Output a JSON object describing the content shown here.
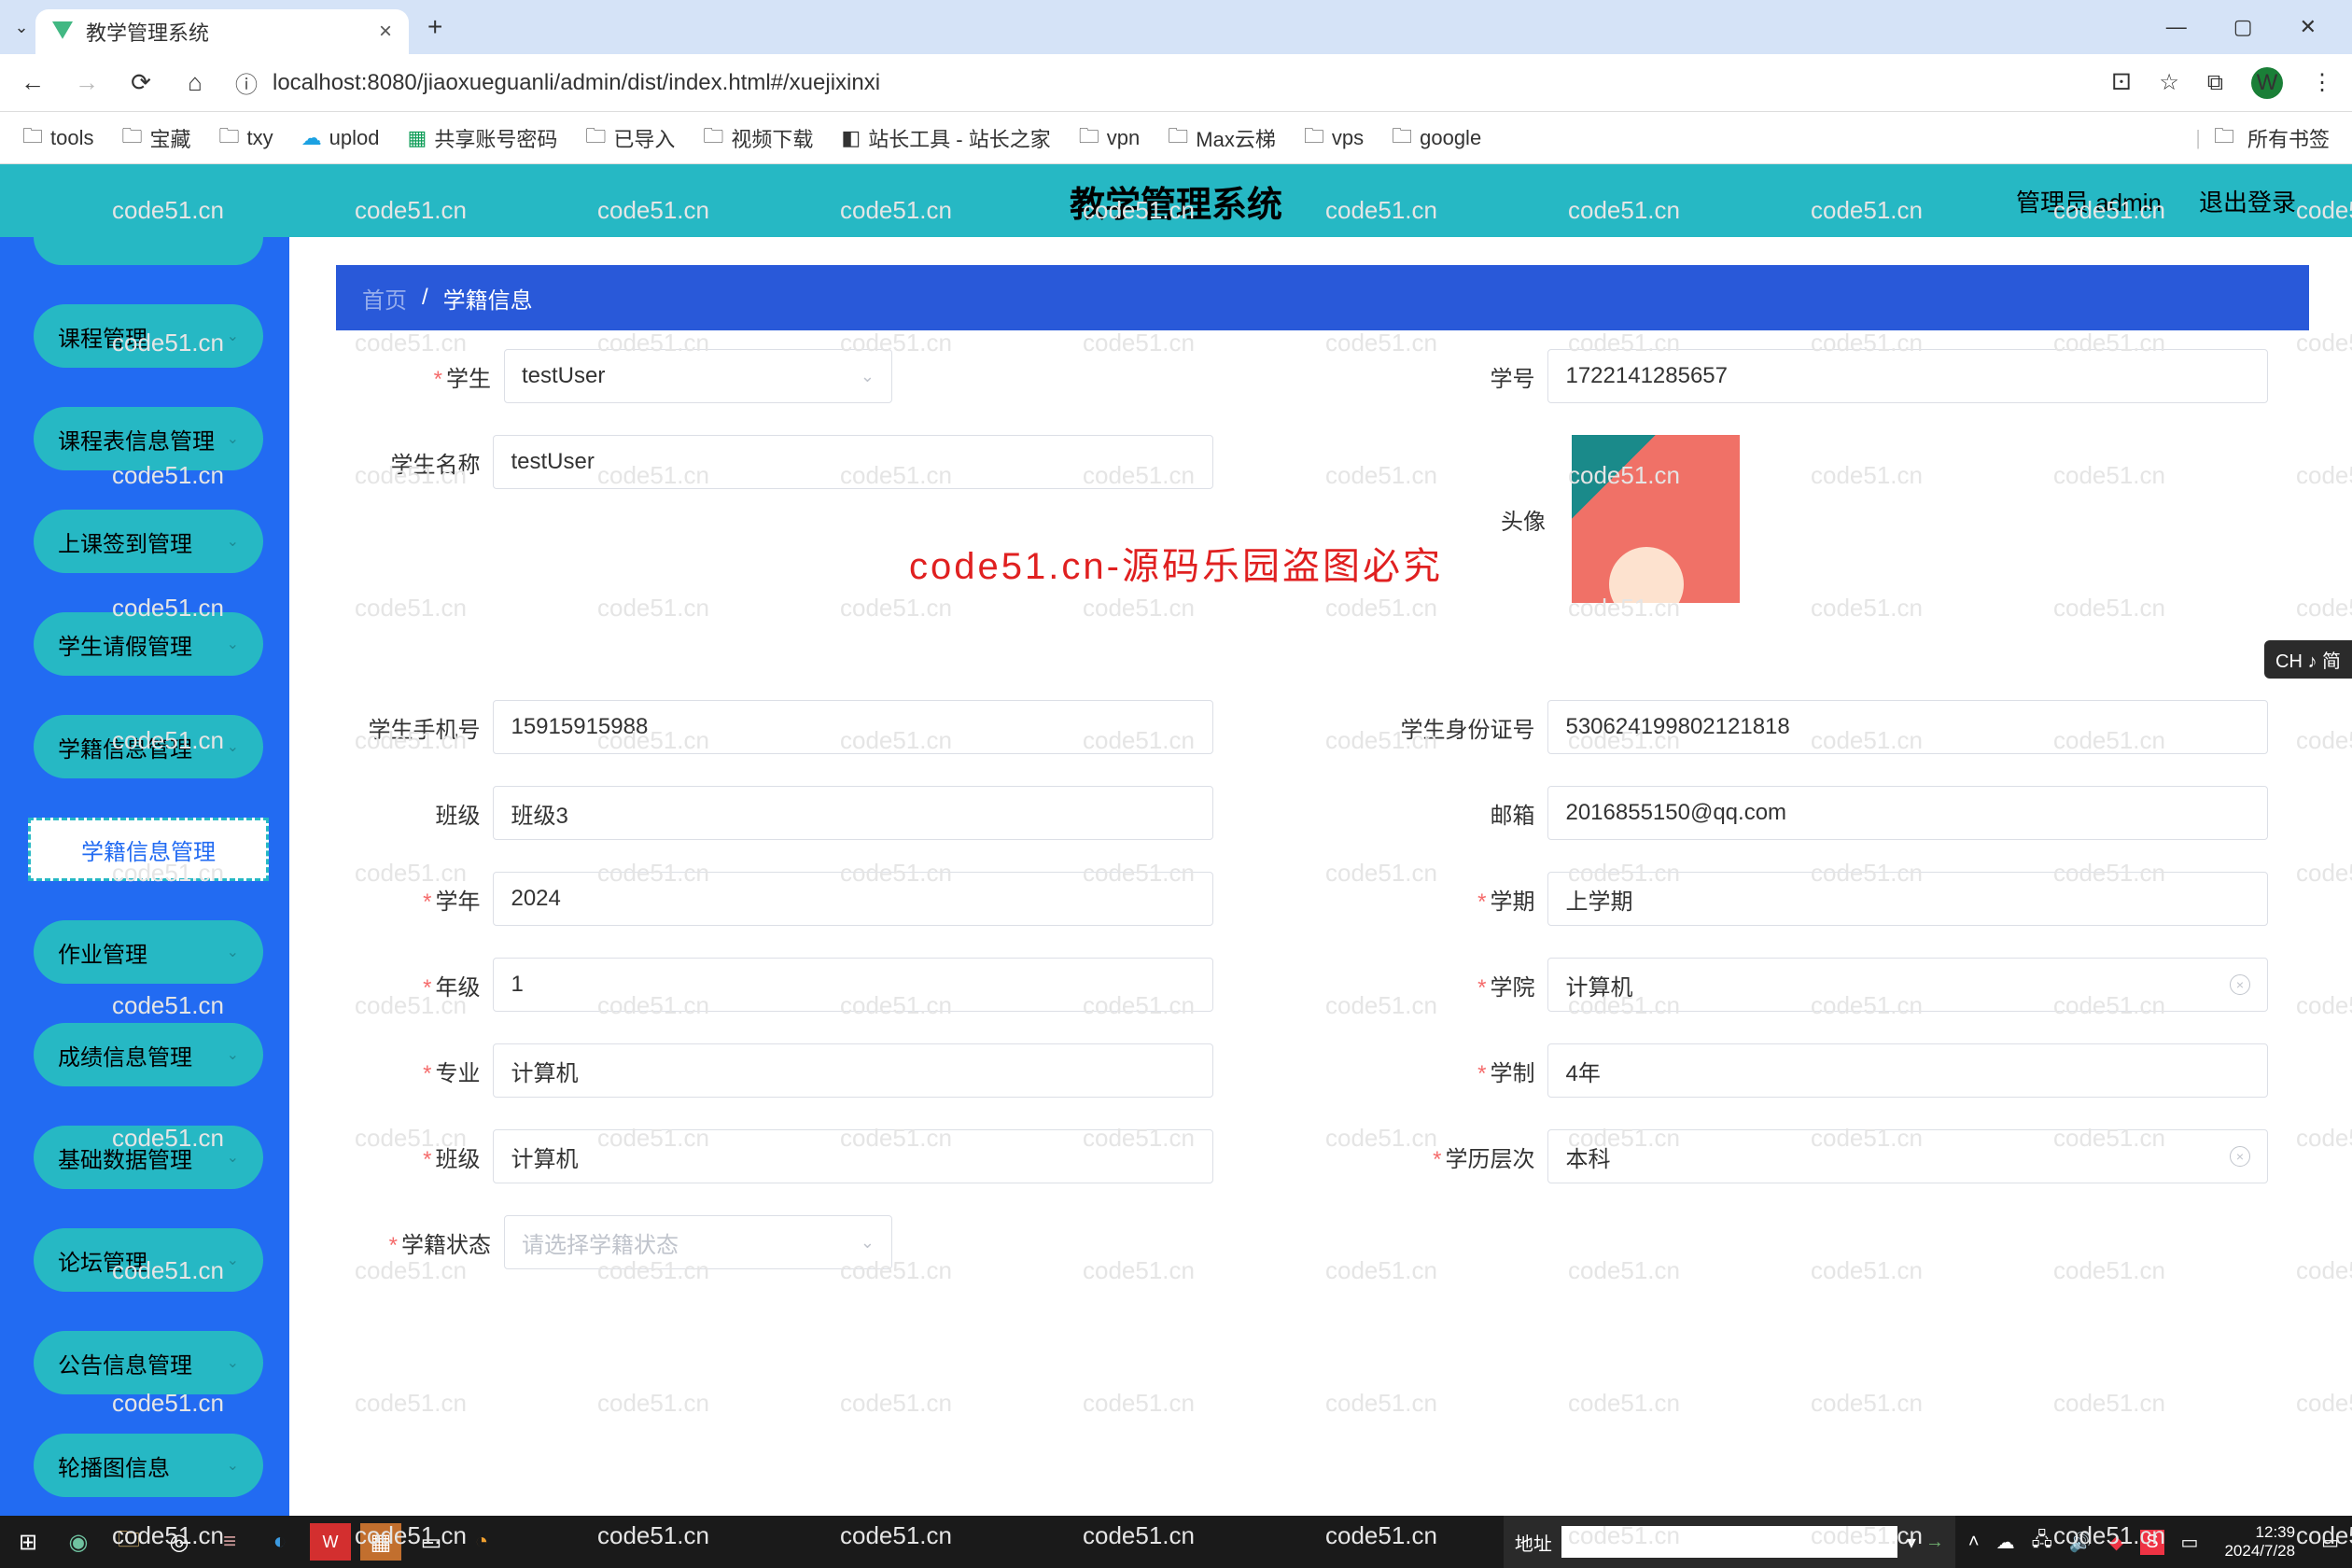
{
  "browser": {
    "tab_title": "教学管理系统",
    "url": "localhost:8080/jiaoxueguanli/admin/dist/index.html#/xuejixinxi",
    "avatar_letter": "W"
  },
  "bookmarks": {
    "items": [
      "tools",
      "宝藏",
      "txy",
      "uplod",
      "共享账号密码",
      "已导入",
      "视频下载",
      "站长工具 - 站长之家",
      "vpn",
      "Max云梯",
      "vps",
      "google"
    ],
    "right": "所有书签"
  },
  "app": {
    "title": "教学管理系统",
    "admin_label": "管理员 admin",
    "logout": "退出登录"
  },
  "sidebar": {
    "items": [
      "课程管理",
      "课程表信息管理",
      "上课签到管理",
      "学生请假管理",
      "学籍信息管理"
    ],
    "active": "学籍信息管理",
    "rest": [
      "作业管理",
      "成绩信息管理",
      "基础数据管理",
      "论坛管理",
      "公告信息管理",
      "轮播图信息"
    ]
  },
  "breadcrumb": {
    "home": "首页",
    "current": "学籍信息"
  },
  "form": {
    "student_label": "学生",
    "student_value": "testUser",
    "student_no_label": "学号",
    "student_no_value": "1722141285657",
    "student_name_label": "学生名称",
    "student_name_value": "testUser",
    "avatar_label": "头像",
    "phone_label": "学生手机号",
    "phone_value": "15915915988",
    "idcard_label": "学生身份证号",
    "idcard_value": "530624199802121818",
    "class_label": "班级",
    "class_value": "班级3",
    "email_label": "邮箱",
    "email_value": "2016855150@qq.com",
    "year_label": "学年",
    "year_value": "2024",
    "semester_label": "学期",
    "semester_value": "上学期",
    "grade_label": "年级",
    "grade_value": "1",
    "college_label": "学院",
    "college_value": "计算机",
    "major_label": "专业",
    "major_value": "计算机",
    "system_label": "学制",
    "system_value": "4年",
    "class2_label": "班级",
    "class2_value": "计算机",
    "edu_label": "学历层次",
    "edu_value": "本科",
    "status_label": "学籍状态",
    "status_placeholder": "请选择学籍状态"
  },
  "watermark": {
    "center": "code51.cn-源码乐园盗图必究",
    "bg": "code51.cn"
  },
  "ime_badge": "CH ♪ 简",
  "taskbar": {
    "addr_label": "地址",
    "time": "12:39",
    "date": "2024/7/28"
  }
}
